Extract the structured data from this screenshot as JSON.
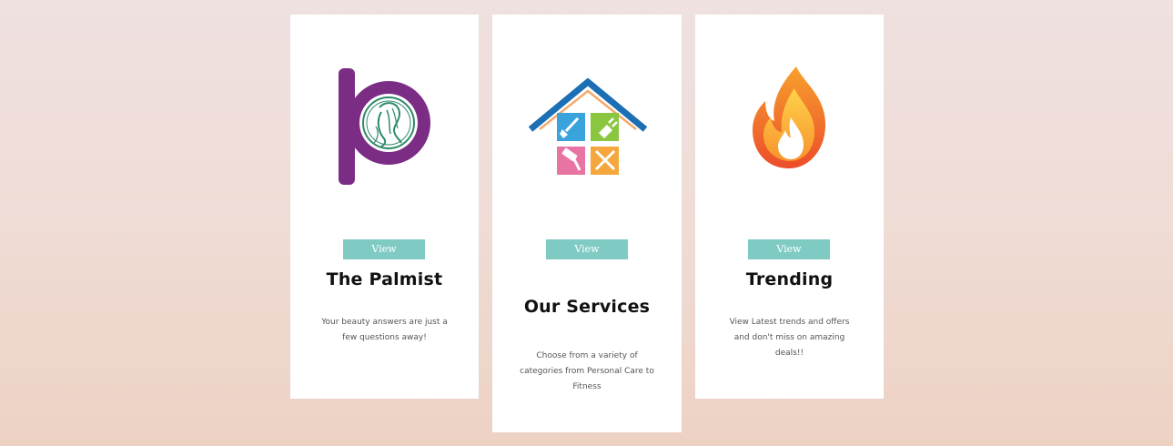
{
  "cards": [
    {
      "id": "palmist",
      "logo_icon": "palmist-logo-icon",
      "button_label": "View",
      "title": "The Palmist",
      "description": "Your beauty answers are just a few questions away!"
    },
    {
      "id": "services",
      "logo_icon": "house-services-icon",
      "button_label": "View",
      "title": "Our Services",
      "description": "Choose from a variety of categories from Personal Care to Fitness"
    },
    {
      "id": "trending",
      "logo_icon": "flame-icon",
      "button_label": "View",
      "title": "Trending",
      "description": "View Latest trends and offers and don't miss on amazing deals!!"
    }
  ],
  "colors": {
    "button": "#7fcbc4",
    "palmist_purple": "#7b2d86",
    "palmist_green": "#2f8a6c",
    "house_roof": "#1c6fb5",
    "flame_red": "#ec4c2b",
    "flame_orange": "#f7a12c"
  }
}
